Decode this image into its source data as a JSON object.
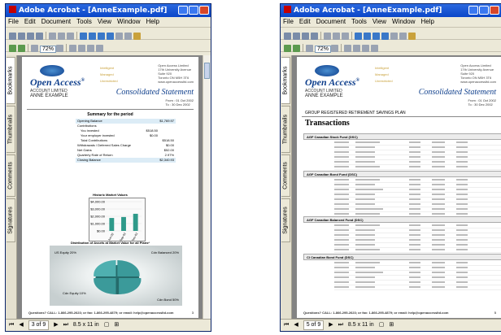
{
  "app": {
    "title": "Adobe Acrobat - [AnneExample.pdf]",
    "menus": [
      "File",
      "Edit",
      "Document",
      "Tools",
      "View",
      "Window",
      "Help"
    ],
    "nav_tabs": [
      "Bookmarks",
      "Thumbnails",
      "Comments",
      "Signatures"
    ]
  },
  "left_window": {
    "zoom": "72%",
    "page_indicator": "3 of 9",
    "page_size": "8.5 x 11 in",
    "doc": {
      "brand": "Open Access",
      "account": "ACCOUNT LIMITED",
      "client": "ANNE EXAMPLE",
      "mid_labels": [
        "Intelligent",
        "Managed",
        "Unrestricted"
      ],
      "address": [
        "Open Access Limited",
        "17th University Avenue",
        "Suite 920",
        "Toronto ON M5H 3T6",
        "www.openaccessltd.com"
      ],
      "statement": "Consolidated Statement",
      "from": "From : 01 Oct 2002",
      "to": "To : 30 Dec 2002",
      "summary_title": "Summary for the period",
      "summary_rows": [
        {
          "label": "Opening Balance",
          "value": "$1,769.97"
        },
        {
          "label": "Contributions",
          "value": ""
        },
        {
          "label": "You invested",
          "value": "$518.50"
        },
        {
          "label": "Your employer invested",
          "value": "$0.00"
        },
        {
          "label": "Total Contributions",
          "value": "$518.50"
        },
        {
          "label": "Withdrawals / Deferred Sales Charge",
          "value": "$0.00"
        },
        {
          "label": "Net Gains",
          "value": "$52.00"
        },
        {
          "label": "Quarterly Rate of Return",
          "value": "2.97%"
        },
        {
          "label": "Closing Balance",
          "value": "$2,340.93"
        }
      ],
      "bar_title": "Historic Market Values",
      "pie_title": "Distribution of Assets at Market Value for all Plans*",
      "pie_labels": [
        "US Equity 20%",
        "Cdn Balanced 20%",
        "Cdn Equity 10%",
        "Cdn Bond 50%"
      ],
      "footer": "Questions? CALL: 1-866-295-2623; or fax: 1-866-295-4879; or email: help@openaccessltd.com",
      "page_num": "3"
    }
  },
  "right_window": {
    "zoom": "72%",
    "page_indicator": "5 of 9",
    "page_size": "8.5 x 11 in",
    "doc": {
      "plan_title": "GROUP REGISTERED RETIREMENT SAVINGS PLAN",
      "heading": "Transactions",
      "sections": [
        "AGF Canadian Stock Fund (DSC)",
        "AGF Canadian Bond Fund (DSC)",
        "AGF Canadian Balanced Fund (DSC)",
        "CI Canadian Bond Fund (DSC)"
      ],
      "page_num": "5"
    }
  },
  "chart_data": {
    "type": "bar",
    "title": "Historic Market Values",
    "categories": [
      "Jun-02",
      "Sep-02",
      "Dec-02"
    ],
    "values": [
      1769.97,
      1900,
      2340.93
    ],
    "ylim": [
      0,
      4000
    ]
  }
}
